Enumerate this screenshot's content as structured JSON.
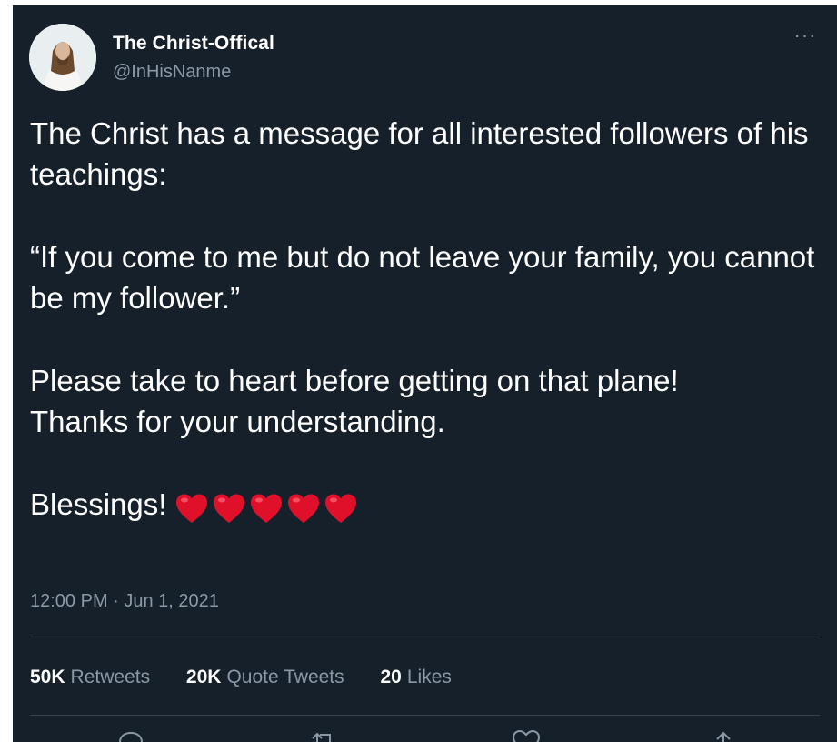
{
  "tweet": {
    "author": {
      "display_name": "The Christ-Offical",
      "handle": "@InHisNanme",
      "avatar_icon": "avatar-jesus-portrait"
    },
    "more_icon": "more-horizontal-icon",
    "more_label": "···",
    "body": {
      "paragraph_1": "The Christ has a message for all interested followers of his teachings:",
      "paragraph_2": "“If you come to me but do not leave your family, you cannot be my follower.”",
      "paragraph_3_line_1": "Please take to heart before getting on that plane!",
      "paragraph_3_line_2": "Thanks for  your understanding.",
      "paragraph_4": "Blessings!",
      "emoji": [
        "red-heart",
        "red-heart",
        "red-heart",
        "red-heart",
        "red-heart"
      ]
    },
    "timestamp": "12:00 PM · Jun 1, 2021",
    "stats": {
      "retweets": {
        "count": "50K",
        "label": "Retweets"
      },
      "quote_tweets": {
        "count": "20K",
        "label": "Quote Tweets"
      },
      "likes": {
        "count": "20",
        "label": "Likes"
      }
    },
    "actions": [
      "reply-icon",
      "retweet-icon",
      "like-icon",
      "share-icon"
    ]
  },
  "colors": {
    "background": "#15202b",
    "text_primary": "#ffffff",
    "text_secondary": "#8b98a5",
    "divider": "#38444d",
    "heart": "#e0102b"
  }
}
